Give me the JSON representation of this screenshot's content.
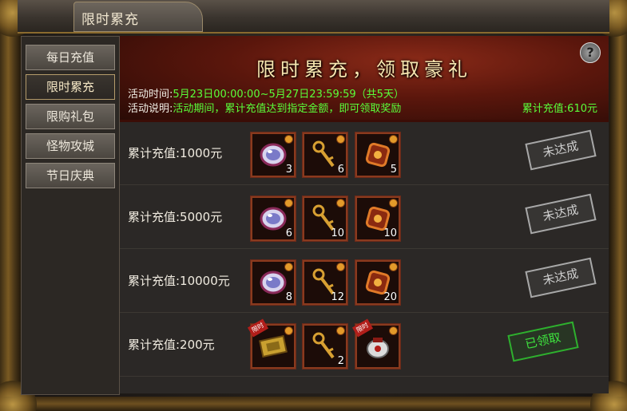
{
  "window": {
    "title": "限时累充"
  },
  "sidebar": {
    "items": [
      {
        "label": "每日充值"
      },
      {
        "label": "限时累充",
        "active": true
      },
      {
        "label": "限购礼包"
      },
      {
        "label": "怪物攻城"
      },
      {
        "label": "节日庆典"
      }
    ]
  },
  "banner": {
    "title": "限时累充，领取豪礼",
    "time_label": "活动时间:",
    "time_value": "5月23日00:00:00~5月27日23:59:59（共5天）",
    "desc_label": "活动说明:",
    "desc_value": "活动期间，累计充值达到指定金额，即可领取奖励",
    "total": "累计充值:610元",
    "help": "?"
  },
  "rewards": [
    {
      "label": "累计充值:1000元",
      "items": [
        {
          "icon": "gem-icon",
          "qty": "3"
        },
        {
          "icon": "key-icon",
          "qty": "6"
        },
        {
          "icon": "rune-box-icon",
          "qty": "5"
        }
      ],
      "status": "未达成"
    },
    {
      "label": "累计充值:5000元",
      "items": [
        {
          "icon": "gem-icon",
          "qty": "6"
        },
        {
          "icon": "key-icon",
          "qty": "10"
        },
        {
          "icon": "rune-box-icon",
          "qty": "10"
        }
      ],
      "status": "未达成"
    },
    {
      "label": "累计充值:10000元",
      "items": [
        {
          "icon": "gem-icon",
          "qty": "8"
        },
        {
          "icon": "key-icon",
          "qty": "12"
        },
        {
          "icon": "rune-box-icon",
          "qty": "20"
        }
      ],
      "status": "未达成"
    },
    {
      "label": "累计充值:200元",
      "items": [
        {
          "icon": "gold-scroll-icon",
          "qty": "",
          "tag": "限时"
        },
        {
          "icon": "key-icon",
          "qty": "2"
        },
        {
          "icon": "silver-pouch-icon",
          "qty": "",
          "tag": "限时"
        }
      ],
      "status": "已领取"
    }
  ],
  "colors": {
    "accent": "#5aff3a",
    "banner": "#6a1a0e",
    "slot_border": "#8a3a1e"
  }
}
